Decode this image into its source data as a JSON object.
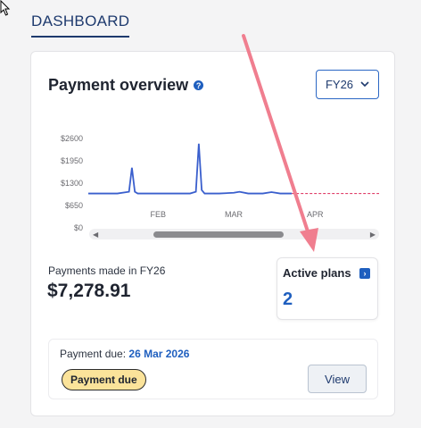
{
  "page": {
    "title": "DASHBOARD"
  },
  "card": {
    "title": "Payment overview",
    "help_icon": "help-circle-icon",
    "year_select": {
      "selected": "FY26"
    }
  },
  "chart_data": {
    "type": "line",
    "x_ticks": [
      "FEB",
      "MAR",
      "APR"
    ],
    "y_ticks": [
      "$2600",
      "$1950",
      "$1300",
      "$650",
      "$0"
    ],
    "ylim": [
      0,
      2600
    ],
    "series": [
      {
        "color": "#3a5fcd",
        "points": [
          [
            0,
            1000
          ],
          [
            5,
            1000
          ],
          [
            10,
            1000
          ],
          [
            14,
            1050
          ],
          [
            15,
            1750
          ],
          [
            16,
            1050
          ],
          [
            17,
            1000
          ],
          [
            20,
            1000
          ],
          [
            25,
            1000
          ],
          [
            30,
            1000
          ],
          [
            35,
            1000
          ],
          [
            37,
            1050
          ],
          [
            38,
            2450
          ],
          [
            39,
            1100
          ],
          [
            40,
            1000
          ],
          [
            45,
            1000
          ],
          [
            50,
            1020
          ],
          [
            52,
            1050
          ],
          [
            55,
            1000
          ],
          [
            60,
            1000
          ],
          [
            63,
            1040
          ],
          [
            66,
            1000
          ],
          [
            70,
            1000
          ]
        ]
      },
      {
        "color": "#e0406a",
        "dashed": true,
        "points": [
          [
            70,
            1000
          ],
          [
            100,
            1000
          ]
        ]
      }
    ],
    "grid": false
  },
  "summary": {
    "payments_label": "Payments made in FY26",
    "payments_amount": "$7,278.91",
    "active_plans_label": "Active plans",
    "active_plans_count": "2"
  },
  "due": {
    "label": "Payment due:",
    "date": "26 Mar 2026",
    "badge": "Payment due",
    "view_label": "View"
  }
}
